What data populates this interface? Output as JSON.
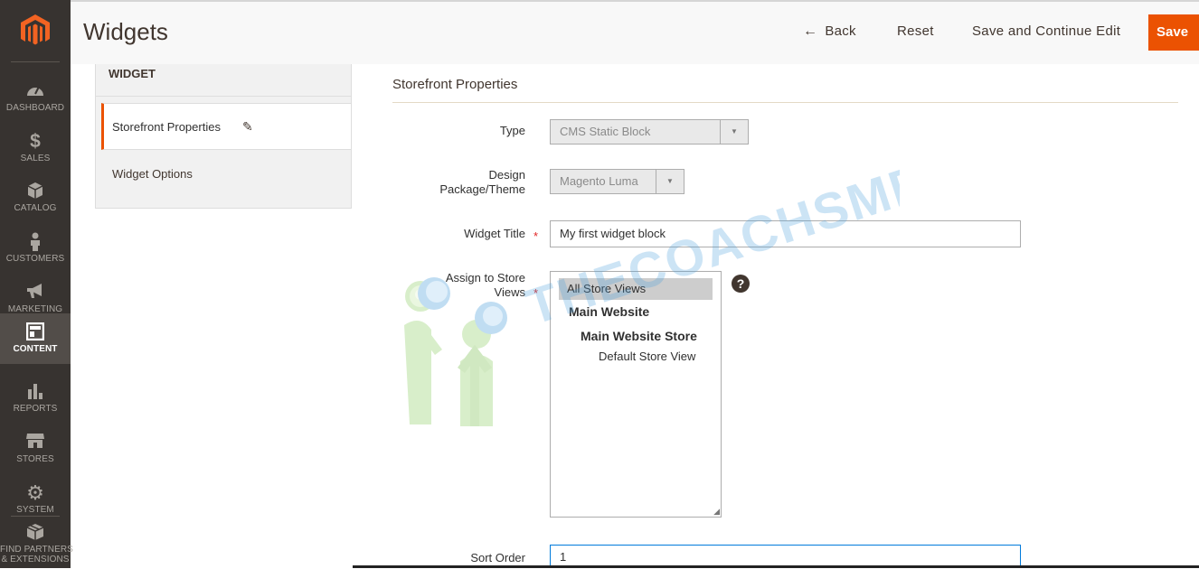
{
  "sidebar": {
    "logo": "magento-logo",
    "items": [
      {
        "label": "DASHBOARD",
        "icon": "dashboard-icon"
      },
      {
        "label": "SALES",
        "icon": "dollar-icon"
      },
      {
        "label": "CATALOG",
        "icon": "cube-icon"
      },
      {
        "label": "CUSTOMERS",
        "icon": "person-icon"
      },
      {
        "label": "MARKETING",
        "icon": "megaphone-icon"
      },
      {
        "label": "CONTENT",
        "icon": "layout-icon",
        "active": true
      },
      {
        "label": "REPORTS",
        "icon": "bar-chart-icon"
      },
      {
        "label": "STORES",
        "icon": "store-icon"
      },
      {
        "label": "SYSTEM",
        "icon": "gear-icon"
      },
      {
        "label": "FIND PARTNERS",
        "label2": "& EXTENSIONS",
        "icon": "box-icon"
      }
    ]
  },
  "header": {
    "title": "Widgets",
    "back": "Back",
    "reset": "Reset",
    "save_continue": "Save and Continue Edit",
    "save": "Save"
  },
  "tabs": {
    "heading": "WIDGET",
    "items": [
      "Storefront Properties",
      "Widget Options"
    ]
  },
  "form": {
    "section_title": "Storefront Properties",
    "type_label": "Type",
    "type_value": "CMS Static Block",
    "theme_label_1": "Design",
    "theme_label_2": "Package/Theme",
    "theme_value": "Magento Luma",
    "title_label": "Widget Title",
    "title_value": "My first widget block",
    "store_label_1": "Assign to Store",
    "store_label_2": "Views",
    "store_options": [
      "All Store Views",
      "Main Website",
      "Main Website Store",
      "Default Store View"
    ],
    "sort_label": "Sort Order",
    "sort_value": "1"
  },
  "watermark": {
    "text": "THECOACHSMB"
  },
  "colors": {
    "accent": "#eb5202",
    "sidebar": "#373330"
  }
}
